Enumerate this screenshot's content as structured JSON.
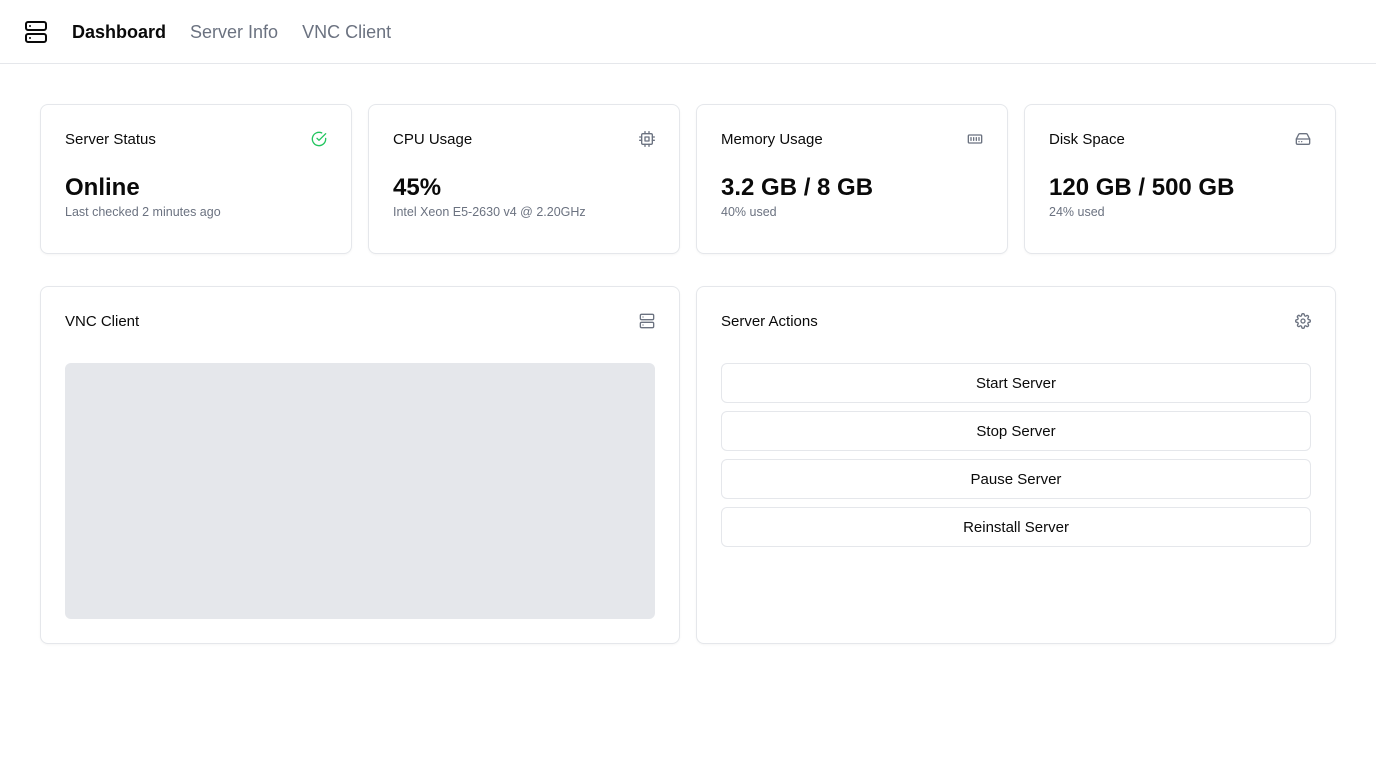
{
  "nav": {
    "logo_icon": "server-icon",
    "items": [
      {
        "label": "Dashboard",
        "active": true
      },
      {
        "label": "Server Info",
        "active": false
      },
      {
        "label": "VNC Client",
        "active": false
      }
    ]
  },
  "stats": {
    "server_status": {
      "title": "Server Status",
      "value": "Online",
      "sub": "Last checked 2 minutes ago",
      "icon": "check-circle-icon",
      "icon_color": "#22c55e"
    },
    "cpu": {
      "title": "CPU Usage",
      "value": "45%",
      "sub": "Intel Xeon E5-2630 v4 @ 2.20GHz",
      "icon": "cpu-icon"
    },
    "memory": {
      "title": "Memory Usage",
      "value": "3.2 GB / 8 GB",
      "sub": "40% used",
      "icon": "memory-stick-icon"
    },
    "disk": {
      "title": "Disk Space",
      "value": "120 GB / 500 GB",
      "sub": "24% used",
      "icon": "hard-drive-icon"
    }
  },
  "vnc": {
    "title": "VNC Client",
    "icon": "server-icon"
  },
  "actions": {
    "title": "Server Actions",
    "icon": "gear-icon",
    "buttons": {
      "start": "Start Server",
      "stop": "Stop Server",
      "pause": "Pause Server",
      "reinstall": "Reinstall Server"
    }
  }
}
